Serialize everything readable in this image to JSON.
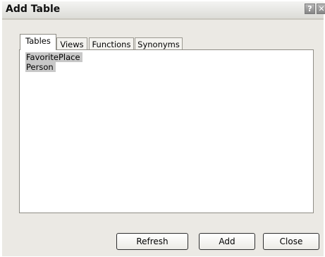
{
  "window": {
    "title": "Add Table",
    "help_glyph": "?",
    "close_glyph": "✕"
  },
  "tabs": [
    {
      "label": "Tables",
      "selected": true
    },
    {
      "label": "Views",
      "selected": false
    },
    {
      "label": "Functions",
      "selected": false
    },
    {
      "label": "Synonyms",
      "selected": false
    }
  ],
  "tables_list": {
    "items": [
      "FavoritePlace",
      "Person"
    ],
    "selected": [
      "FavoritePlace",
      "Person"
    ]
  },
  "buttons": {
    "refresh": "Refresh",
    "add": "Add",
    "close": "Close"
  },
  "colors": {
    "dialog_bg": "#ebe9e4",
    "selection": "#c8c8c8"
  },
  "icons": {
    "help": "help-icon",
    "close": "close-icon"
  }
}
